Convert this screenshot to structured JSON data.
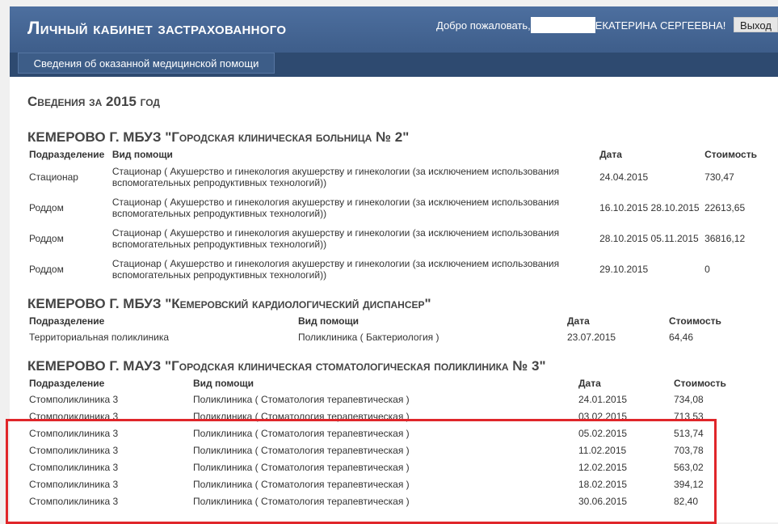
{
  "header": {
    "title": "Личный кабинет застрахованного",
    "welcome_prefix": "Добро пожаловать,",
    "welcome_name": "ЕКАТЕРИНА СЕРГЕЕВНА!",
    "logout_label": "Выход"
  },
  "nav": {
    "tab_label": "Сведения об оказанной медицинской помощи"
  },
  "main": {
    "year_title": "Сведения за 2015 год",
    "orgs": [
      {
        "name": "КЕМЕРОВО Г. МБУЗ \"Городская клиническая больница № 2\"",
        "columns": [
          "Подразделение",
          "Вид помощи",
          "Дата",
          "Стоимость"
        ],
        "rows": [
          [
            "Стационар",
            "Стационар ( Акушерство и гинекология акушерству и гинекологии (за исключением использования вспомогательных репродуктивных технологий))",
            "24.04.2015",
            "730,47"
          ],
          [
            "Роддом",
            "Стационар ( Акушерство и гинекология акушерству и гинекологии (за исключением использования вспомогательных репродуктивных технологий))",
            "16.10.2015 28.10.2015",
            "22613,65"
          ],
          [
            "Роддом",
            "Стационар ( Акушерство и гинекология акушерству и гинекологии (за исключением использования вспомогательных репродуктивных технологий))",
            "28.10.2015 05.11.2015",
            "36816,12"
          ],
          [
            "Роддом",
            "Стационар ( Акушерство и гинекология акушерству и гинекологии (за исключением использования вспомогательных репродуктивных технологий))",
            "29.10.2015",
            "0"
          ]
        ]
      },
      {
        "name": "КЕМЕРОВО Г. МБУЗ \"Кемеровский кардиологический диспансер\"",
        "columns": [
          "Подразделение",
          "Вид помощи",
          "Дата",
          "Стоимость"
        ],
        "rows": [
          [
            "Территориальная поликлиника",
            "Поликлиника ( Бактериология )",
            "23.07.2015",
            "64,46"
          ]
        ]
      },
      {
        "name": "КЕМЕРОВО Г. МАУЗ \"Городская клиническая стоматологическая поликлиника № 3\"",
        "columns": [
          "Подразделение",
          "Вид помощи",
          "Дата",
          "Стоимость"
        ],
        "rows": [
          [
            "Стомполиклиника 3",
            "Поликлиника ( Стоматология терапевтическая )",
            "24.01.2015",
            "734,08"
          ],
          [
            "Стомполиклиника 3",
            "Поликлиника ( Стоматология терапевтическая )",
            "03.02.2015",
            "713,53"
          ],
          [
            "Стомполиклиника 3",
            "Поликлиника ( Стоматология терапевтическая )",
            "05.02.2015",
            "513,74"
          ],
          [
            "Стомполиклиника 3",
            "Поликлиника ( Стоматология терапевтическая )",
            "11.02.2015",
            "703,78"
          ],
          [
            "Стомполиклиника 3",
            "Поликлиника ( Стоматология терапевтическая )",
            "12.02.2015",
            "563,02"
          ],
          [
            "Стомполиклиника 3",
            "Поликлиника ( Стоматология терапевтическая )",
            "18.02.2015",
            "394,12"
          ],
          [
            "Стомполиклиника 3",
            "Поликлиника ( Стоматология терапевтическая )",
            "30.06.2015",
            "82,40"
          ]
        ]
      }
    ]
  },
  "colors": {
    "header_bg": "#4d6f9f",
    "navbar_bg": "#2e4a70",
    "highlight_border": "#e0262a"
  }
}
